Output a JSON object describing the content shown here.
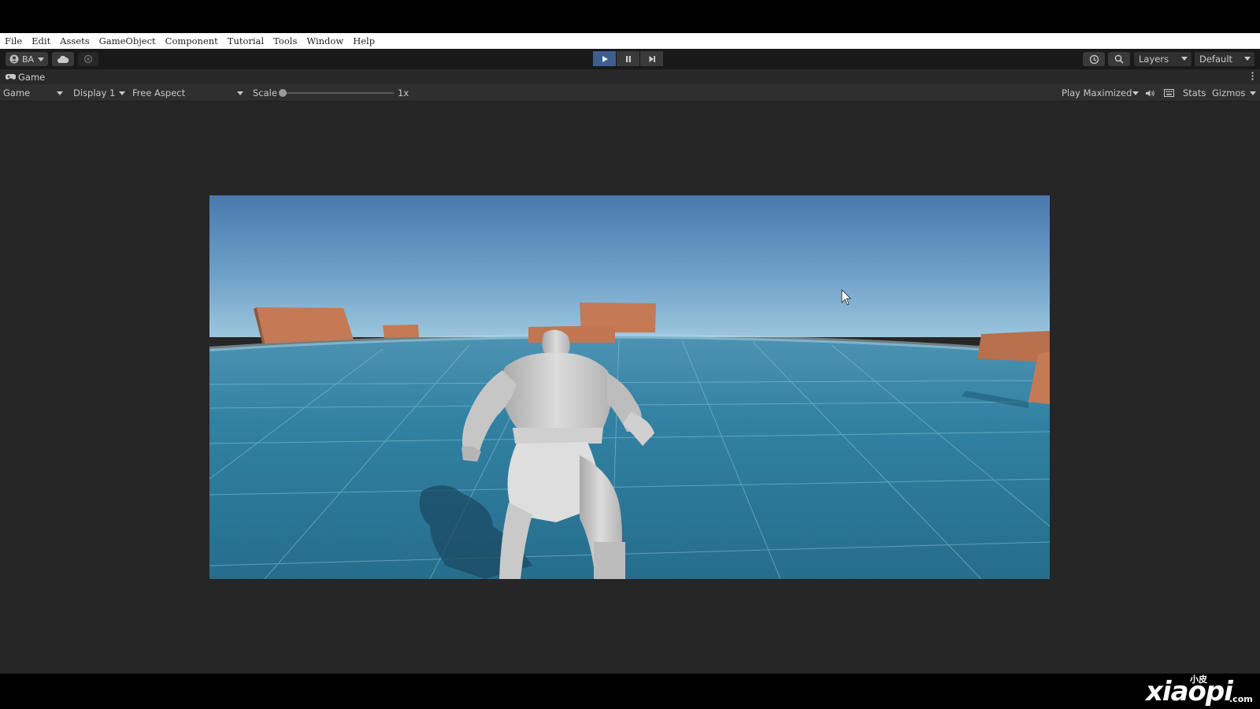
{
  "menu": [
    "File",
    "Edit",
    "Assets",
    "GameObject",
    "Component",
    "Tutorial",
    "Tools",
    "Window",
    "Help"
  ],
  "toolbar": {
    "account_label": "BA",
    "layers_label": "Layers",
    "layout_label": "Default"
  },
  "tab": {
    "title": "Game"
  },
  "game_bar": {
    "view_select": "Game",
    "display_select": "Display 1",
    "aspect_select": "Free Aspect",
    "scale_label": "Scale",
    "scale_value_label": "1x",
    "scale_value": 0.0,
    "play_mode_select": "Play Maximized",
    "stats_label": "Stats",
    "gizmos_label": "Gizmos"
  },
  "watermark": {
    "cn_text": "小皮",
    "latin_text": "xiaopi",
    "suffix": ".com"
  },
  "colors": {
    "play_active": "#3c5f8f",
    "sky_top": "#4a79ae",
    "sky_horizon": "#8fb9d6",
    "ground": "#2f7a9c",
    "crate": "#c47a55"
  }
}
